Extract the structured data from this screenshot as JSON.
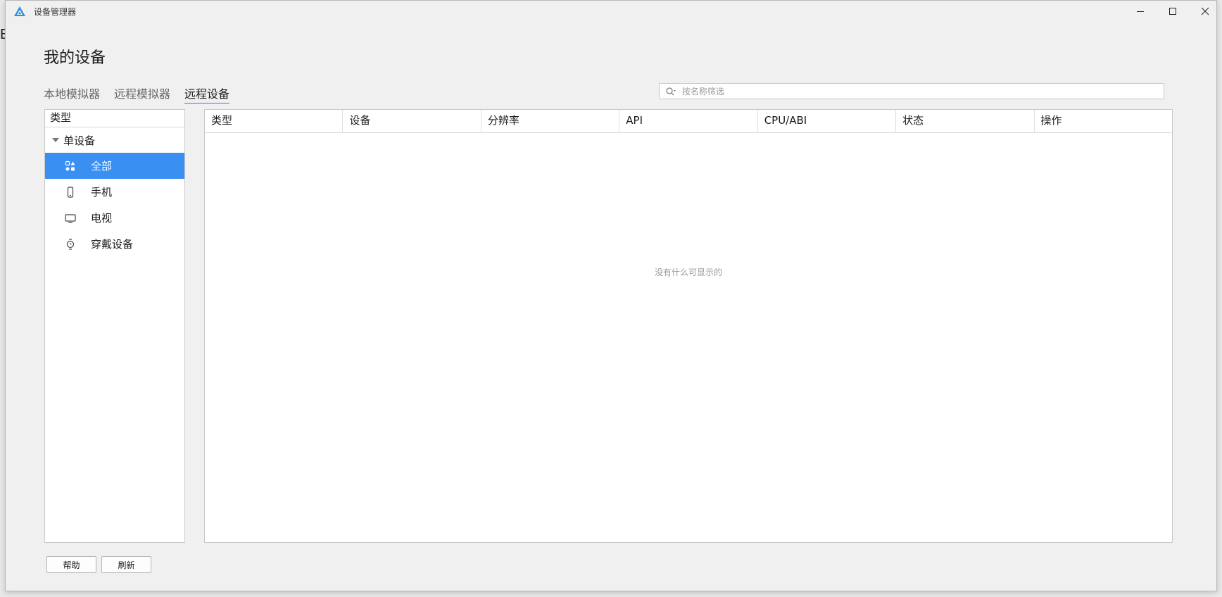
{
  "background": {
    "letter": "E"
  },
  "window": {
    "title": "设备管理器"
  },
  "page": {
    "title": "我的设备"
  },
  "tabs": [
    {
      "label": "本地模拟器",
      "active": false
    },
    {
      "label": "远程模拟器",
      "active": false
    },
    {
      "label": "远程设备",
      "active": true
    }
  ],
  "search": {
    "placeholder": "按名称筛选",
    "value": ""
  },
  "sidebar": {
    "header": "类型",
    "group": {
      "label": "单设备",
      "expanded": true
    },
    "items": [
      {
        "label": "全部",
        "icon": "grid-icon",
        "selected": true
      },
      {
        "label": "手机",
        "icon": "phone-icon",
        "selected": false
      },
      {
        "label": "电视",
        "icon": "tv-icon",
        "selected": false
      },
      {
        "label": "穿戴设备",
        "icon": "watch-icon",
        "selected": false
      }
    ]
  },
  "table": {
    "columns": [
      "类型",
      "设备",
      "分辨率",
      "API",
      "CPU/ABI",
      "状态",
      "操作"
    ],
    "empty_text": "没有什么可显示的"
  },
  "footer": {
    "help_label": "帮助",
    "refresh_label": "刷新"
  },
  "colors": {
    "accent": "#3a8ff2",
    "tab_underline": "#2f7fd6"
  }
}
